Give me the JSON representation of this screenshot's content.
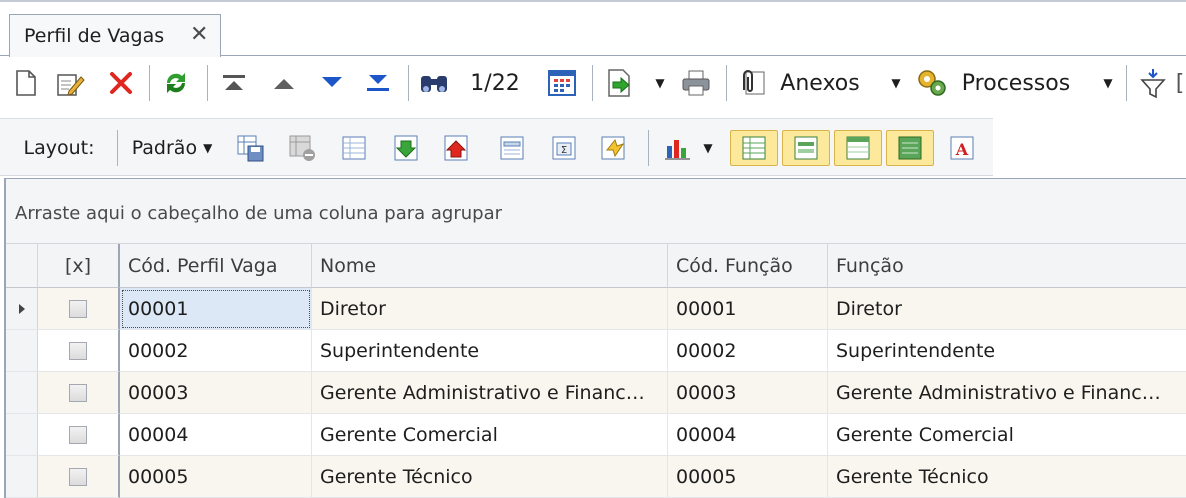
{
  "tab": {
    "title": "Perfil de Vagas",
    "close_glyph": "✕"
  },
  "toolbar": {
    "record_counter": "1/22",
    "anexos_label": "Anexos",
    "processos_label": "Processos",
    "icons": [
      "new-document-icon",
      "edit-icon",
      "delete-icon",
      "refresh-icon",
      "first-record-icon",
      "previous-record-icon",
      "next-record-icon",
      "last-record-icon",
      "search-binoculars-icon",
      "calendar-grid-icon",
      "export-icon",
      "print-icon",
      "attachment-icon",
      "processes-gear-icon",
      "filter-icon"
    ]
  },
  "layout_bar": {
    "label": "Layout:",
    "preset": "Padrão",
    "icons": [
      "save-layout-icon",
      "delete-layout-icon",
      "grid-layout-icon",
      "import-layout-icon",
      "export-layout-icon",
      "columns-layout-icon",
      "sum-layout-icon",
      "restore-layout-icon",
      "chart-icon",
      "view-grid-icon",
      "view-list-icon",
      "view-detail-icon",
      "view-green-icon",
      "font-icon"
    ]
  },
  "grid": {
    "group_hint": "Arraste aqui o cabeçalho de uma coluna para agrupar",
    "columns": [
      "[x]",
      "Cód. Perfil Vaga",
      "Nome",
      "Cód. Função",
      "Função"
    ],
    "rows": [
      {
        "cod_perfil": "00001",
        "nome": "Diretor",
        "cod_funcao": "00001",
        "funcao": "Diretor"
      },
      {
        "cod_perfil": "00002",
        "nome": "Superintendente",
        "cod_funcao": "00002",
        "funcao": "Superintendente"
      },
      {
        "cod_perfil": "00003",
        "nome": "Gerente Administrativo e Financ…",
        "cod_funcao": "00003",
        "funcao": "Gerente Administrativo e Financ…"
      },
      {
        "cod_perfil": "00004",
        "nome": "Gerente Comercial",
        "cod_funcao": "00004",
        "funcao": "Gerente Comercial"
      },
      {
        "cod_perfil": "00005",
        "nome": "Gerente Técnico",
        "cod_funcao": "00005",
        "funcao": "Gerente Técnico"
      }
    ]
  }
}
